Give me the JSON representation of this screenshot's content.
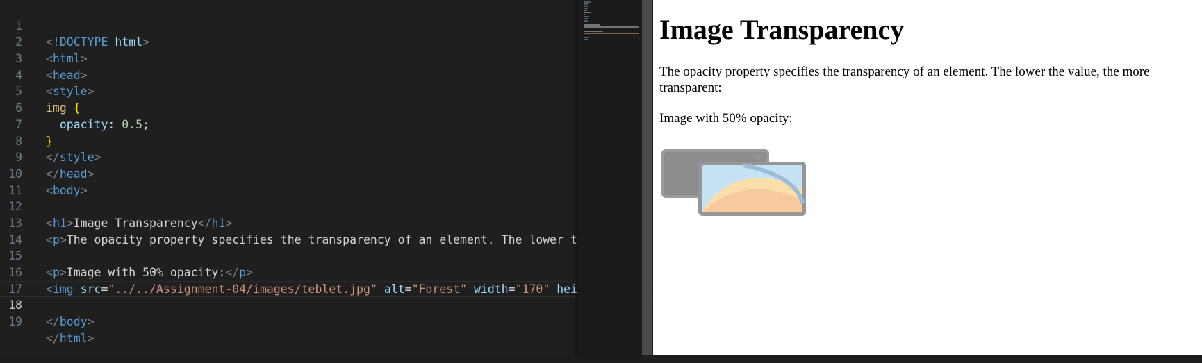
{
  "editor": {
    "lines": [
      {
        "n": "1"
      },
      {
        "n": "2"
      },
      {
        "n": "3"
      },
      {
        "n": "4"
      },
      {
        "n": "5"
      },
      {
        "n": "6"
      },
      {
        "n": "7"
      },
      {
        "n": "8"
      },
      {
        "n": "9"
      },
      {
        "n": "10"
      },
      {
        "n": "11"
      },
      {
        "n": "12"
      },
      {
        "n": "13"
      },
      {
        "n": "14"
      },
      {
        "n": "15"
      },
      {
        "n": "16"
      },
      {
        "n": "17"
      },
      {
        "n": "18"
      },
      {
        "n": "19"
      }
    ],
    "current_line": "18",
    "code": {
      "l1_doctype": "!DOCTYPE",
      "l1_html": "html",
      "tag_html": "html",
      "tag_head": "head",
      "tag_style": "style",
      "l5_selector": "img",
      "l6_prop": "opacity",
      "l6_value": "0.5",
      "tag_body": "body",
      "tag_h1": "h1",
      "l12_text": "Image Transparency",
      "tag_p": "p",
      "l13_text": "The opacity property specifies the transparency of an element. The lower the value, the more transparent:",
      "l15_text": "Image with 50% opacity:",
      "tag_img": "img",
      "attr_src": "src",
      "val_src": "../../Assignment-04/images/teblet.jpg",
      "attr_alt": "alt",
      "val_alt": "\"Forest\"",
      "attr_width": "width",
      "val_width": "\"170\"",
      "attr_height": "height"
    }
  },
  "preview": {
    "heading": "Image Transparency",
    "paragraph": "The opacity property specifies the transparency of an element. The lower the value, the more transparent:",
    "caption": "Image with 50% opacity:",
    "image_alt": "Forest",
    "image_opacity": 0.5
  },
  "colors": {
    "editor_bg": "#1f1f1f",
    "tag": "#569cd6",
    "attribute": "#9cdcfe",
    "string": "#ce9178",
    "selector": "#d7ba7d",
    "number": "#b5cea8",
    "preview_bg": "#ffffff"
  }
}
